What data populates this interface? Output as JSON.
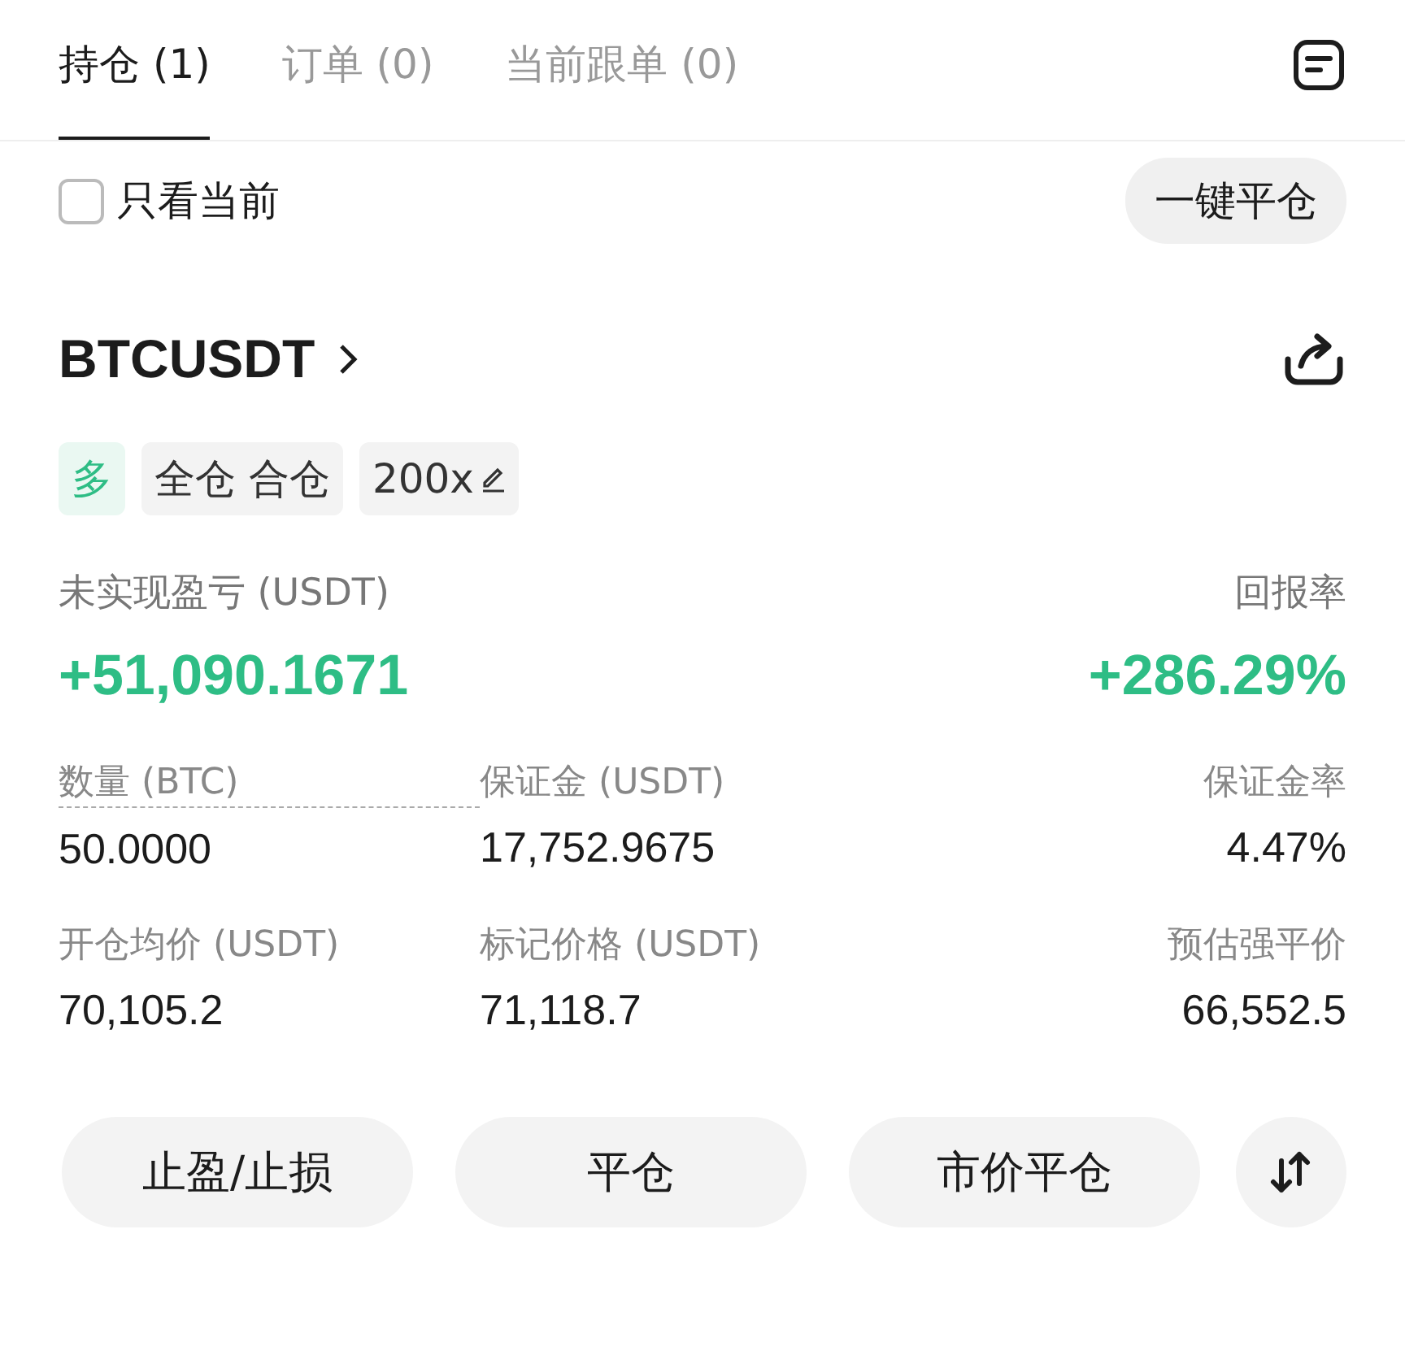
{
  "tabs": [
    {
      "label": "持仓 (1)",
      "selected": true
    },
    {
      "label": "订单 (0)",
      "selected": false
    },
    {
      "label": "当前跟单 (0)",
      "selected": false
    }
  ],
  "filter": {
    "label": "只看当前",
    "checked": false
  },
  "close_all_button": "一键平仓",
  "position": {
    "symbol": "BTCUSDT",
    "tags": [
      {
        "kind": "side",
        "text": "多"
      },
      {
        "kind": "plain",
        "text": "全仓 合仓"
      },
      {
        "kind": "leverage",
        "text": "200x"
      }
    ],
    "pnl_label": "未实现盈亏 (USDT)",
    "pnl_value": "+51,090.1671",
    "roe_label": "回报率",
    "roe_value": "+286.29%",
    "metrics": [
      {
        "label": "数量 (BTC)",
        "value": "50.0000",
        "dashed": true
      },
      {
        "label": "保证金 (USDT)",
        "value": "17,752.9675",
        "dashed": false
      },
      {
        "label": "保证金率",
        "value": "4.47%",
        "dashed": false
      },
      {
        "label": "开仓均价 (USDT)",
        "value": "70,105.2",
        "dashed": false
      },
      {
        "label": "标记价格 (USDT)",
        "value": "71,118.7",
        "dashed": false
      },
      {
        "label": "预估强平价",
        "value": "66,552.5",
        "dashed": false
      }
    ]
  },
  "actions": [
    "止盈/止损",
    "平仓",
    "市价平仓"
  ]
}
